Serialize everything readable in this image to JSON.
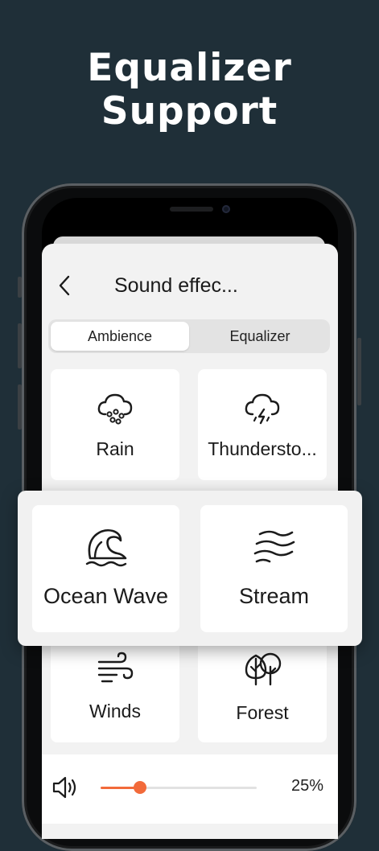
{
  "headline": {
    "line1": "Equalizer",
    "line2": "Support"
  },
  "header": {
    "title": "Sound effec..."
  },
  "tabs": [
    {
      "label": "Ambience",
      "selected": true
    },
    {
      "label": "Equalizer",
      "selected": false
    }
  ],
  "sounds": {
    "rain": {
      "label": "Rain",
      "icon": "cloud-rain-icon"
    },
    "thunderstorm": {
      "label": "Thundersto...",
      "icon": "cloud-lightning-icon"
    },
    "ocean_wave": {
      "label": "Ocean Wave",
      "icon": "wave-icon"
    },
    "stream": {
      "label": "Stream",
      "icon": "stream-icon"
    },
    "winds": {
      "label": "Winds",
      "icon": "wind-icon"
    },
    "forest": {
      "label": "Forest",
      "icon": "trees-icon"
    }
  },
  "volume": {
    "value_text": "25%",
    "level": 0.25,
    "icon": "speaker-icon"
  },
  "colors": {
    "background": "#1f2f38",
    "accent": "#f26a3a"
  }
}
